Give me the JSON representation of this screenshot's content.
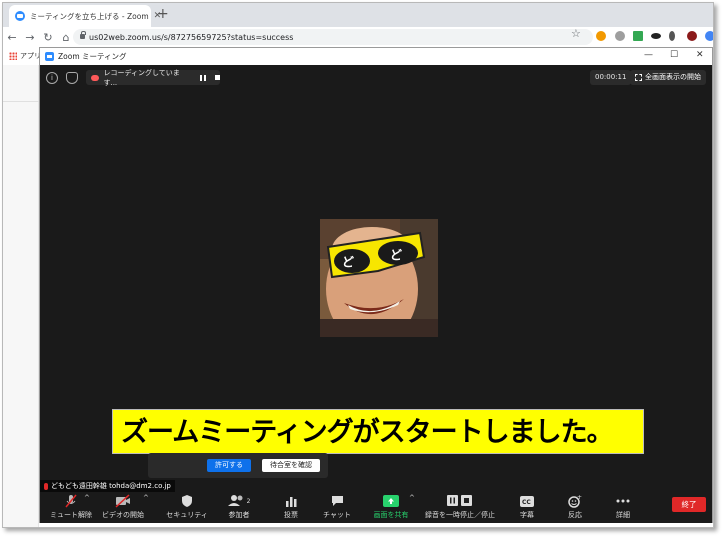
{
  "browser": {
    "tab_title": "ミーティングを立ち上げる - Zoom",
    "tab_close": "✕",
    "new_tab": "+",
    "url": "us02web.zoom.us/s/87275659725?status=success",
    "bookmarks_label": "アプリ"
  },
  "zoom": {
    "window_title": "Zoom ミーティング",
    "recording_label": "レコーディングしています...",
    "timer": "00:00:11",
    "fullscreen_label": "全画面表示の開始",
    "caption": "ズームミーティングがスタートしました。",
    "waiting_room": {
      "allow_label": "許可する",
      "view_label": "待合室を確認"
    },
    "participant_name": "どもども遠田幹雄 tohda@dm2.co.jp",
    "participants_count": "2",
    "controls": {
      "unmute": "ミュート解除",
      "start_video": "ビデオの開始",
      "security": "セキュリティ",
      "participants": "参加者",
      "polls": "投票",
      "chat": "チャット",
      "share_screen": "画面を共有",
      "recording": "録音を一時停止／停止",
      "captions": "字幕",
      "reactions": "反応",
      "more": "詳細",
      "end": "終了"
    }
  },
  "colors": {
    "zoom_blue": "#2d8cff",
    "caption_bg": "#ffff00",
    "end_red": "#e02828",
    "share_green": "#28d26d"
  }
}
